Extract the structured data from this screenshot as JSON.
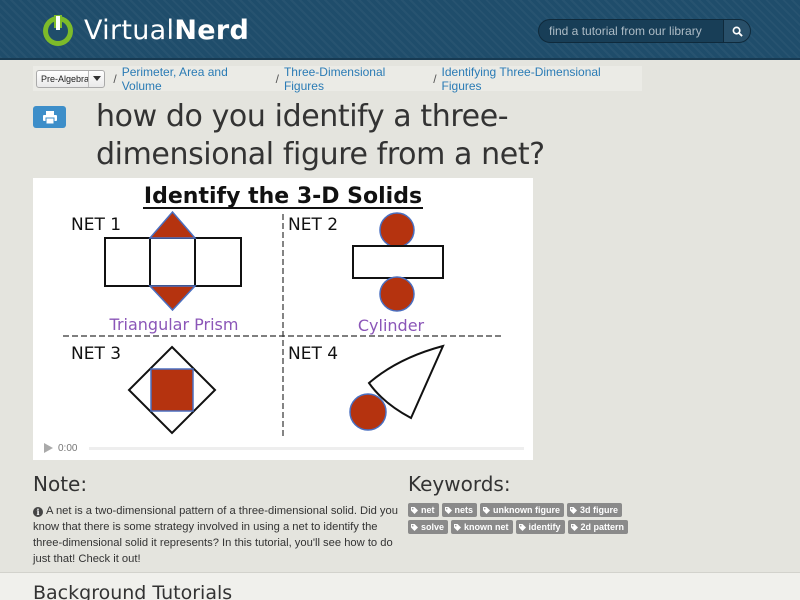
{
  "header": {
    "logo_virtual": "Virtual",
    "logo_nerd": "Nerd",
    "search_placeholder": "find a tutorial from our library",
    "accent": "#1f4d6b"
  },
  "breadcrumb": {
    "subject": "Pre-Algebra",
    "items": [
      "Perimeter, Area and Volume",
      "Three-Dimensional Figures",
      "Identifying Three-Dimensional Figures"
    ]
  },
  "title": "how do you identify a three-dimensional figure from a net?",
  "video": {
    "frame_title": "Identify the 3-D Solids",
    "net1_label": "NET 1",
    "net2_label": "NET 2",
    "net3_label": "NET 3",
    "net4_label": "NET 4",
    "net1_answer": "Triangular Prism",
    "net2_answer": "Cylinder",
    "time": "0:00",
    "fill_color": "#b5330f",
    "answer_color": "#8b56b8"
  },
  "note": {
    "heading": "Note:",
    "text": "A net is a two-dimensional pattern of a three-dimensional solid. Did you know that there is some strategy involved in using a net to identify the three-dimensional solid it represents? In this tutorial, you'll see how to do just that! Check it out!"
  },
  "keywords": {
    "heading": "Keywords:",
    "tags": [
      "net",
      "nets",
      "unknown figure",
      "3d figure",
      "solve",
      "known net",
      "identify",
      "2d pattern"
    ]
  },
  "background": {
    "heading": "Background Tutorials"
  }
}
